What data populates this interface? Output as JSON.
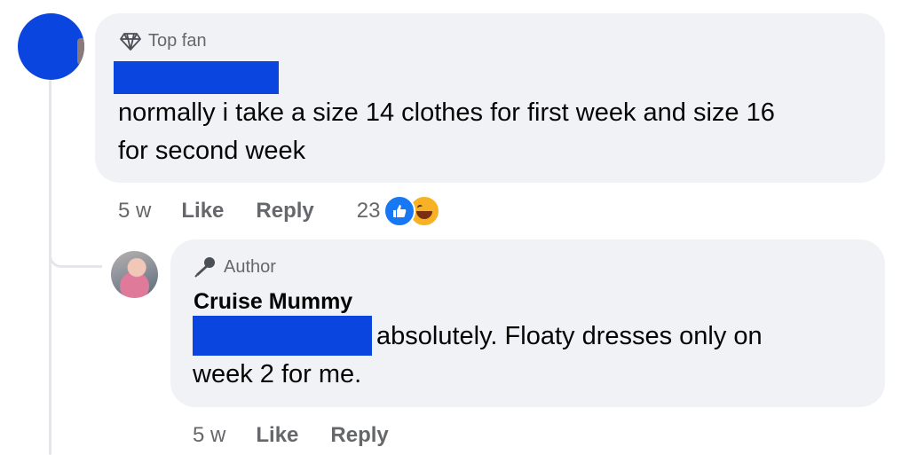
{
  "comment": {
    "badge": "Top fan",
    "text_line1": "normally i take a size 14 clothes for first week and size 16",
    "text_line2": "for second week",
    "time": "5 w",
    "like_label": "Like",
    "reply_label": "Reply",
    "reaction_count": "23",
    "reactions": [
      "like-icon",
      "haha-icon"
    ]
  },
  "reply": {
    "badge": "Author",
    "author": "Cruise Mummy",
    "text_line1": "absolutely. Floaty dresses only on",
    "text_line2": "week 2 for me.",
    "time": "5 w",
    "like_label": "Like",
    "reply_label": "Reply"
  },
  "colors": {
    "redaction": "#0b45e0",
    "bubble": "#f0f2f5",
    "meta_text": "#65676b",
    "like_blue": "#1877f2"
  }
}
